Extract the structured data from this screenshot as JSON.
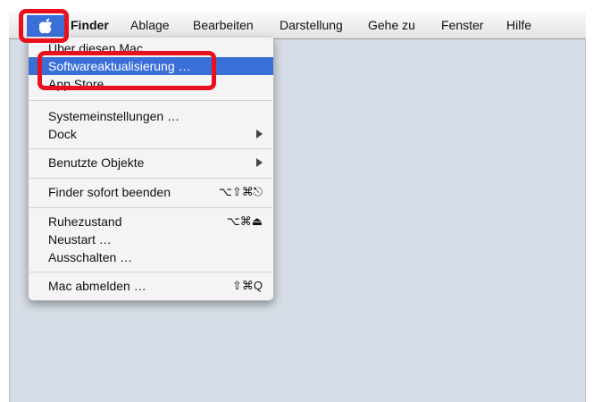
{
  "menubar": {
    "apple_icon": "apple-logo-icon",
    "items": [
      "Finder",
      "Ablage",
      "Bearbeiten",
      "Darstellung",
      "Gehe zu",
      "Fenster",
      "Hilfe"
    ]
  },
  "apple_menu": {
    "about": "Über diesen Mac",
    "software_update": "Softwareaktualisierung …",
    "app_store": "App Store …",
    "system_prefs": "Systemeinstellungen …",
    "dock": "Dock",
    "recent_items": "Benutzte Objekte",
    "force_quit": "Finder sofort beenden",
    "force_quit_shortcut": "⌥⇧⌘⎋",
    "sleep": "Ruhezustand",
    "sleep_shortcut": "⌥⌘⏏",
    "restart": "Neustart …",
    "shutdown": "Ausschalten …",
    "logout": "Mac abmelden …",
    "logout_shortcut": "⇧⌘Q"
  },
  "colors": {
    "highlight": "#e8101c",
    "selection": "#3a6fd8"
  }
}
